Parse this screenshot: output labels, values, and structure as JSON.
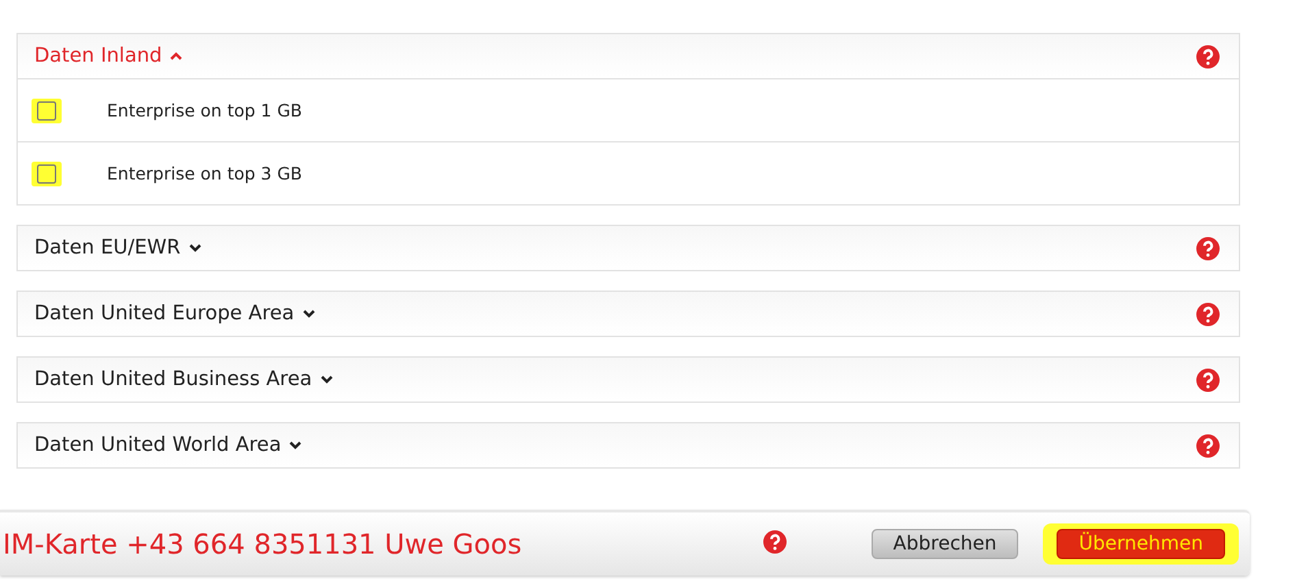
{
  "sections": [
    {
      "title": "Daten Inland",
      "expanded": true,
      "options": [
        {
          "label": "Enterprise on top 1 GB",
          "checked": false,
          "highlighted": true
        },
        {
          "label": "Enterprise on top 3 GB",
          "checked": false,
          "highlighted": true
        }
      ]
    },
    {
      "title": "Daten EU/EWR",
      "expanded": false
    },
    {
      "title": "Daten United Europe Area",
      "expanded": false
    },
    {
      "title": "Daten United Business Area",
      "expanded": false
    },
    {
      "title": "Daten United World Area",
      "expanded": false
    }
  ],
  "footer": {
    "title": "IM-Karte +43 664 8351131 Uwe Goos",
    "buttons": [
      {
        "label": "Abbrechen",
        "kind": "secondary",
        "highlighted": false
      },
      {
        "label": "Übernehmen",
        "kind": "primary",
        "highlighted": true
      }
    ]
  }
}
